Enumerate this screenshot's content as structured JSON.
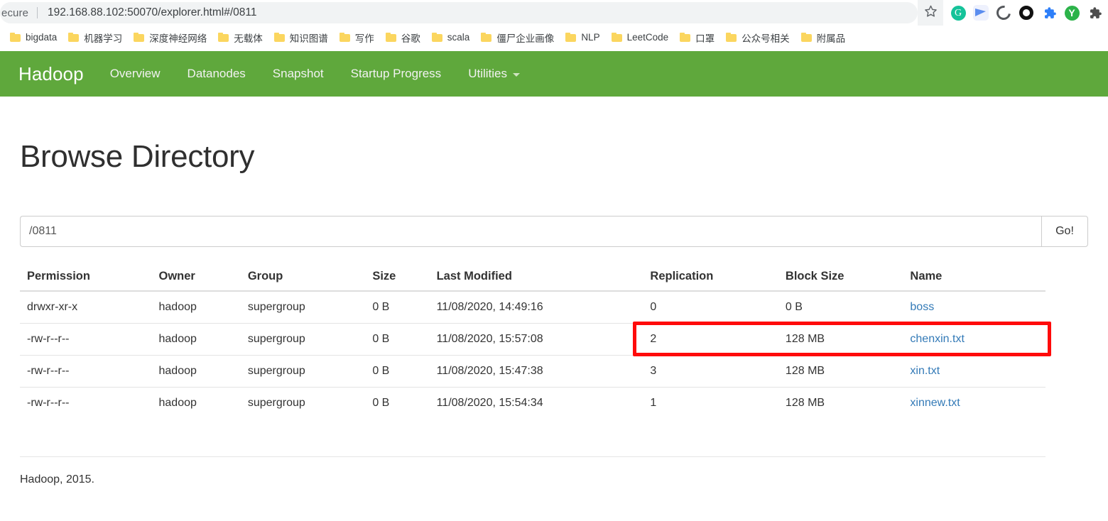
{
  "browser": {
    "omnibox": {
      "security_label": "ecure",
      "url": "192.168.88.102:50070/explorer.html#/0811",
      "star_icon": "star-icon"
    },
    "extensions": [
      {
        "name": "grammarly-extension-icon",
        "glyph": "G"
      },
      {
        "name": "bird-extension-icon",
        "glyph": ""
      },
      {
        "name": "spiral-extension-icon",
        "glyph": ""
      },
      {
        "name": "ring-extension-icon",
        "glyph": ""
      },
      {
        "name": "puzzle-extension-icon",
        "glyph": ""
      },
      {
        "name": "youdao-extension-icon",
        "glyph": "Y"
      },
      {
        "name": "extensions-menu-icon",
        "glyph": ""
      }
    ],
    "bookmarks": [
      {
        "label": "bigdata"
      },
      {
        "label": "机器学习"
      },
      {
        "label": "深度神经网络"
      },
      {
        "label": "无载体"
      },
      {
        "label": "知识图谱"
      },
      {
        "label": "写作"
      },
      {
        "label": "谷歌"
      },
      {
        "label": "scala"
      },
      {
        "label": "僵尸企业画像"
      },
      {
        "label": "NLP"
      },
      {
        "label": "LeetCode"
      },
      {
        "label": "口罩"
      },
      {
        "label": "公众号相关"
      },
      {
        "label": "附属品"
      }
    ]
  },
  "navbar": {
    "brand": "Hadoop",
    "background_color": "#5FA83C",
    "links": [
      {
        "label": "Overview",
        "has_caret": false
      },
      {
        "label": "Datanodes",
        "has_caret": false
      },
      {
        "label": "Snapshot",
        "has_caret": false
      },
      {
        "label": "Startup Progress",
        "has_caret": false
      },
      {
        "label": "Utilities",
        "has_caret": true
      }
    ]
  },
  "page": {
    "title": "Browse Directory",
    "path_value": "/0811",
    "path_placeholder": "/",
    "go_label": "Go!",
    "footer": "Hadoop, 2015."
  },
  "table": {
    "headers": [
      "Permission",
      "Owner",
      "Group",
      "Size",
      "Last Modified",
      "Replication",
      "Block Size",
      "Name"
    ],
    "rows": [
      {
        "permission": "drwxr-xr-x",
        "owner": "hadoop",
        "group": "supergroup",
        "size": "0 B",
        "modified": "11/08/2020, 14:49:16",
        "replication": "0",
        "blocksize": "0 B",
        "name": "boss"
      },
      {
        "permission": "-rw-r--r--",
        "owner": "hadoop",
        "group": "supergroup",
        "size": "0 B",
        "modified": "11/08/2020, 15:57:08",
        "replication": "2",
        "blocksize": "128 MB",
        "name": "chenxin.txt"
      },
      {
        "permission": "-rw-r--r--",
        "owner": "hadoop",
        "group": "supergroup",
        "size": "0 B",
        "modified": "11/08/2020, 15:47:38",
        "replication": "3",
        "blocksize": "128 MB",
        "name": "xin.txt"
      },
      {
        "permission": "-rw-r--r--",
        "owner": "hadoop",
        "group": "supergroup",
        "size": "0 B",
        "modified": "11/08/2020, 15:54:34",
        "replication": "1",
        "blocksize": "128 MB",
        "name": "xinnew.txt"
      }
    ]
  },
  "annotation": {
    "highlight_color": "#FF0A0A",
    "target_row_name": "chenxin.txt"
  }
}
